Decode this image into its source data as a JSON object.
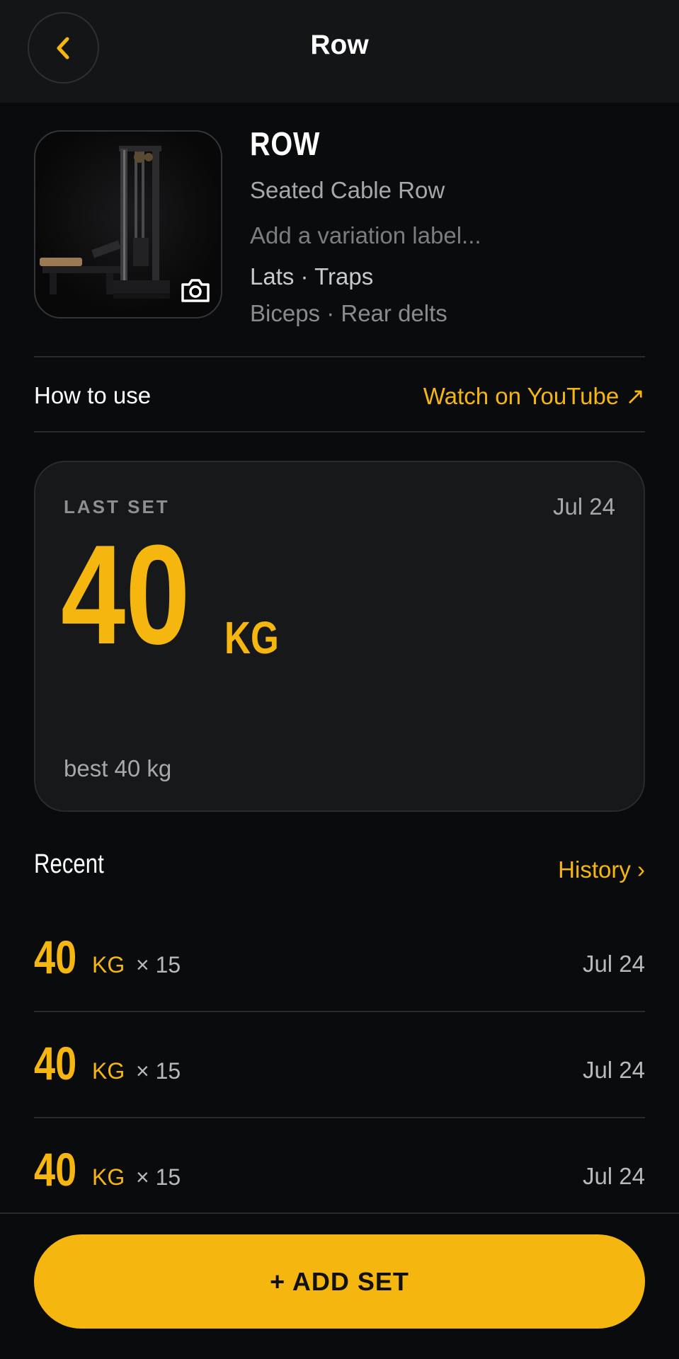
{
  "header": {
    "title": "Row",
    "back_icon": "chevron-left-icon"
  },
  "exercise": {
    "name": "ROW",
    "subtitle": "Seated Cable Row",
    "variation_placeholder": "Add a variation label...",
    "primary_muscles": "Lats · Traps",
    "secondary_muscles": "Biceps · Rear delts",
    "camera_icon": "camera-icon"
  },
  "how_to": {
    "label": "How to use",
    "link_label": "Watch on YouTube ↗"
  },
  "last_set": {
    "label": "LAST SET",
    "date": "Jul 24",
    "value": "40",
    "unit": "KG",
    "best": "best 40 kg"
  },
  "recent": {
    "title": "Recent",
    "history_label": "History ›",
    "items": [
      {
        "weight": "40",
        "unit": "KG",
        "reps": "× 15",
        "date": "Jul 24"
      },
      {
        "weight": "40",
        "unit": "KG",
        "reps": "× 15",
        "date": "Jul 24"
      },
      {
        "weight": "40",
        "unit": "KG",
        "reps": "× 15",
        "date": "Jul 24"
      }
    ]
  },
  "add_set_label": "+ ADD SET",
  "colors": {
    "accent": "#f5b60f",
    "background": "#0a0b0d",
    "card": "#17181a"
  }
}
